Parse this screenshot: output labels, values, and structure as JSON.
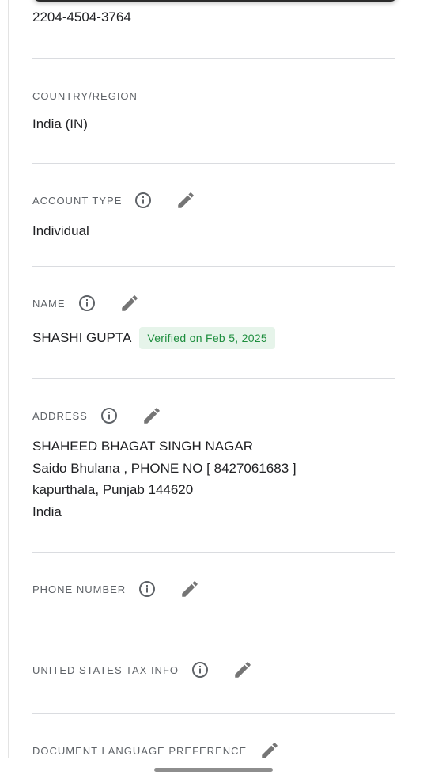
{
  "account_id": "2204-4504-3764",
  "country": {
    "label": "COUNTRY/REGION",
    "value": "India (IN)"
  },
  "account_type": {
    "label": "ACCOUNT TYPE",
    "value": "Individual"
  },
  "name": {
    "label": "NAME",
    "value": "SHASHI GUPTA",
    "badge": "Verified on Feb 5, 2025"
  },
  "address": {
    "label": "ADDRESS",
    "lines": [
      "SHAHEED BHAGAT SINGH NAGAR",
      "Saido Bhulana , PHONE NO [ 8427061683 ]",
      "kapurthala, Punjab 144620",
      "India"
    ]
  },
  "phone": {
    "label": "PHONE NUMBER"
  },
  "tax": {
    "label": "UNITED STATES TAX INFO"
  },
  "doc_lang": {
    "label": "DOCUMENT LANGUAGE PREFERENCE"
  },
  "icons": {
    "info": "info-icon",
    "edit": "pencil-icon"
  },
  "colors": {
    "verified_bg": "#e6f4ea",
    "verified_text": "#1e8e3e",
    "label": "#5f6368"
  }
}
